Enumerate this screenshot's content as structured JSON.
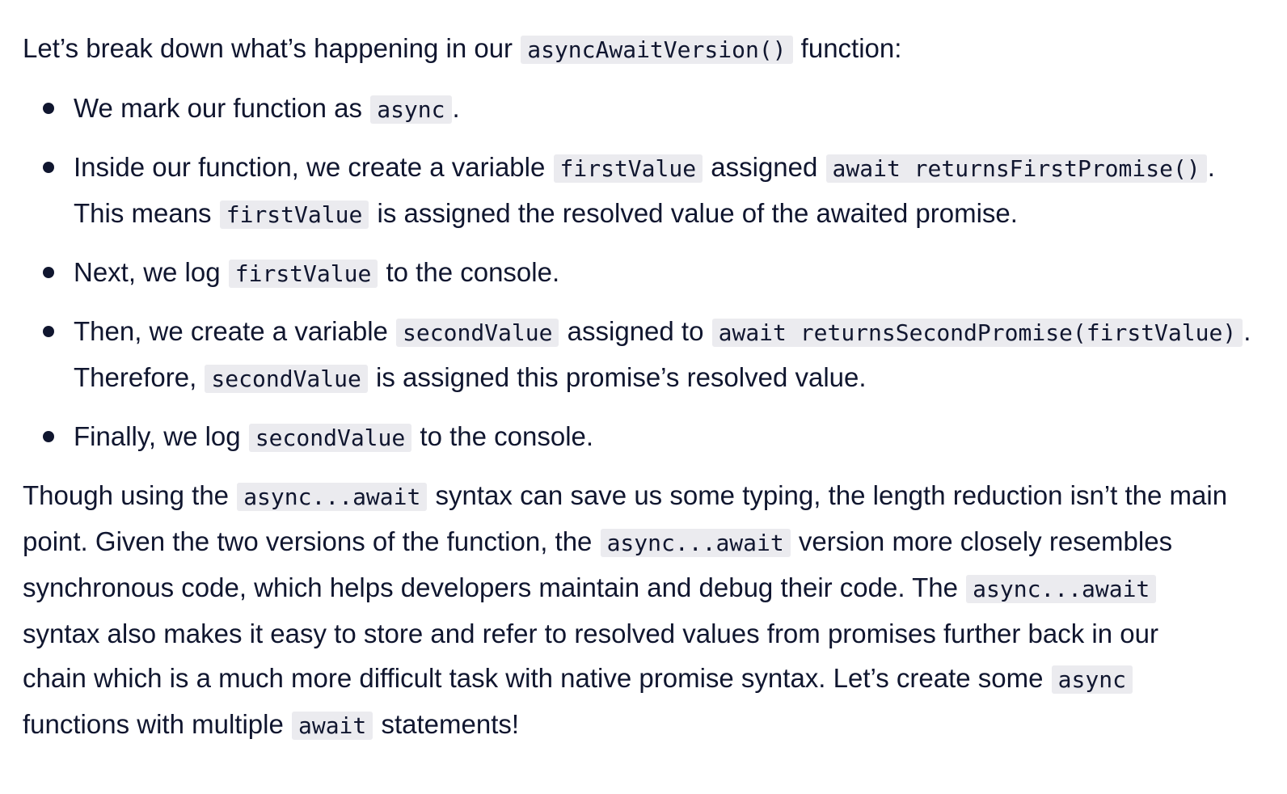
{
  "intro": {
    "prefix": "Let’s break down what’s happening in our ",
    "code": "asyncAwaitVersion()",
    "suffix": " function:"
  },
  "steps": [
    {
      "t1": "We mark our function as ",
      "c1": "async",
      "t2": "."
    },
    {
      "t1": "Inside our function, we create a variable ",
      "c1": "firstValue",
      "t2": " assigned ",
      "c2": "await returnsFirstPromise()",
      "t3": ".",
      "t4": "This means ",
      "c3": "firstValue",
      "t5": " is assigned the resolved value of the awaited promise."
    },
    {
      "t1": "Next, we log ",
      "c1": "firstValue",
      "t2": " to the console."
    },
    {
      "t1": "Then, we create a variable ",
      "c1": "secondValue",
      "t2": " assigned to ",
      "c2": "await returnsSecondPromise(firstValue)",
      "t3": ".",
      "t4": "Therefore, ",
      "c3": "secondValue",
      "t5": " is assigned this promise’s resolved value."
    },
    {
      "t1": "Finally, we log ",
      "c1": "secondValue",
      "t2": " to the console."
    }
  ],
  "outro": {
    "l1_a": "Though using the ",
    "l1_code": "async...await",
    "l1_b": " syntax can save us some typing, the length reduction isn’t the main",
    "l2_a": "point. Given the two versions of the function, the ",
    "l2_code": "async...await",
    "l2_b": " version more closely resembles",
    "l3_a": "synchronous code, which helps developers maintain and debug their code. The ",
    "l3_code": "async...await",
    "l4": "syntax also makes it easy to store and refer to resolved values from promises further back in our",
    "l5_a": "chain which is a much more difficult task with native promise syntax. Let’s create some ",
    "l5_code": "async",
    "l6_a": "functions with multiple ",
    "l6_code": "await",
    "l6_b": " statements!"
  }
}
